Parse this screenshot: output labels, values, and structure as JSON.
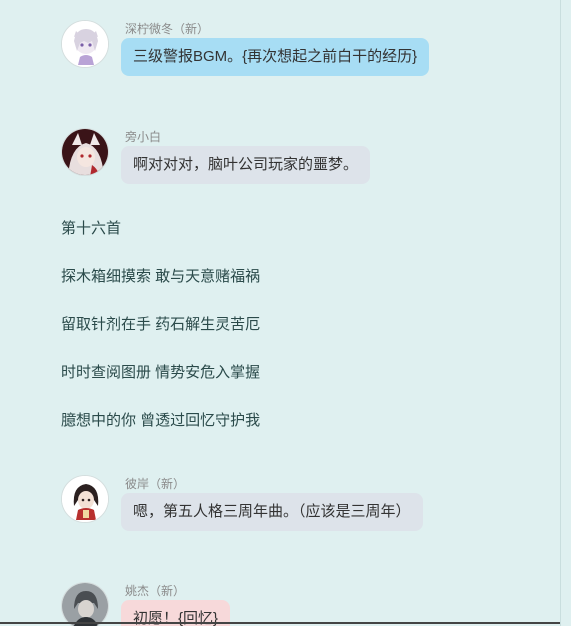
{
  "comments": [
    {
      "username": "深柠微冬（新）",
      "text": "三级警报BGM。{再次想起之前白干的经历}",
      "bubble_color": "#a7ddf4"
    },
    {
      "username": "旁小白",
      "text": "啊对对对，脑叶公司玩家的噩梦。",
      "bubble_color": "#dde3ea"
    },
    {
      "username": "彼岸（新）",
      "text": "嗯，第五人格三周年曲。（应该是三周年）",
      "bubble_color": "#dde3ea"
    },
    {
      "username": "姚杰（新）",
      "text": "初愿！{回忆}",
      "bubble_color": "#f7d9da"
    }
  ],
  "lyrics": {
    "title": "第十六首",
    "lines": [
      "探木箱细摸索 敢与天意赌福祸",
      "留取针剂在手 药石解生灵苦厄",
      "时时查阅图册 情势安危入掌握",
      "臆想中的你 曾透过回忆守护我"
    ]
  }
}
